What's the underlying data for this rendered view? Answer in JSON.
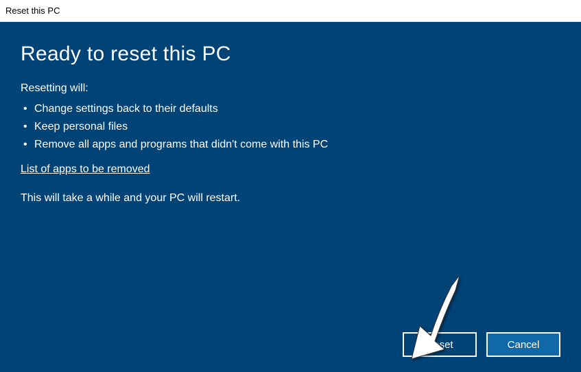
{
  "window": {
    "title": "Reset this PC"
  },
  "dialog": {
    "heading": "Ready to reset this PC",
    "resetting_label": "Resetting will:",
    "bullets": [
      "Change settings back to their defaults",
      "Keep personal files",
      "Remove all apps and programs that didn't come with this PC"
    ],
    "link": "List of apps to be removed",
    "note": "This will take a while and your PC will restart.",
    "buttons": {
      "reset": "Reset",
      "cancel": "Cancel"
    }
  },
  "colors": {
    "dialog_bg": "#004377",
    "primary_btn": "#1168a6"
  }
}
